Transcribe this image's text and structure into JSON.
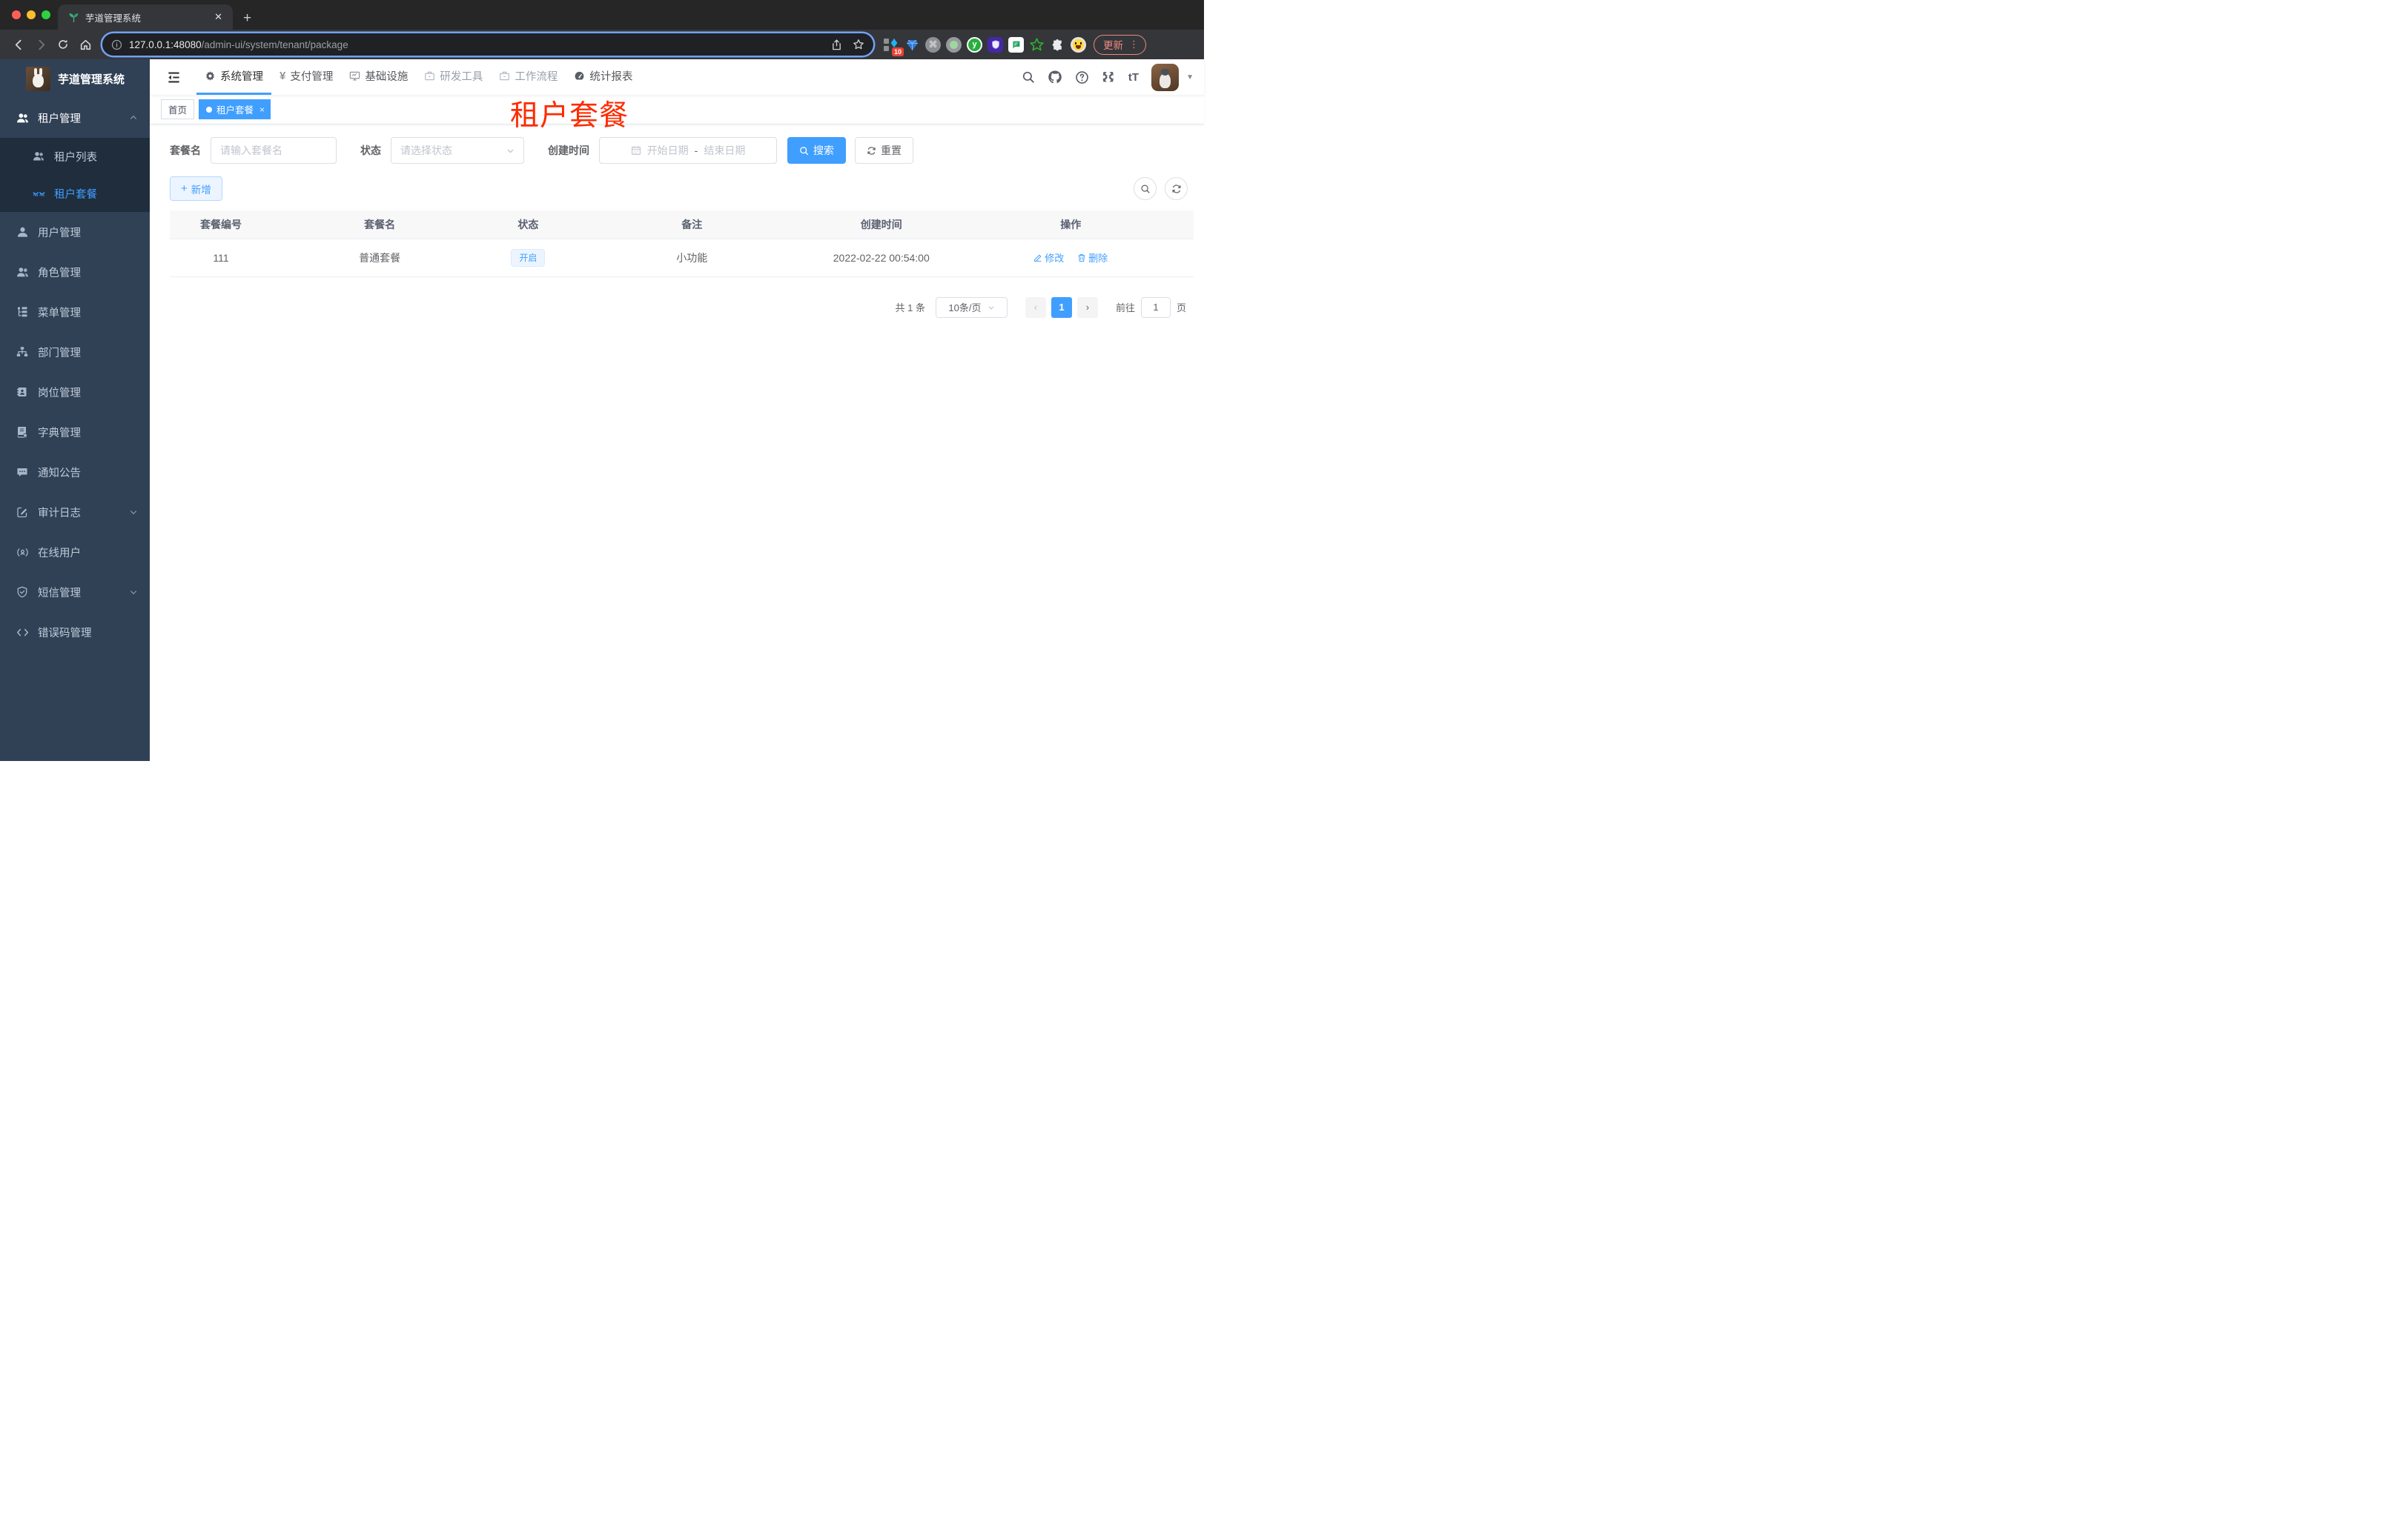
{
  "browser": {
    "tab_title": "芋道管理系统",
    "new_tab": "+",
    "close_tab": "✕",
    "url_host": "127.0.0.1:48080",
    "url_path": "/admin-ui/system/tenant/package",
    "ext_badge": "10",
    "cmd_glyph": "⌘",
    "update_label": "更新",
    "menu_dots": "⋮"
  },
  "colors": {
    "accent": "#409eff",
    "sidebar_bg": "#304156",
    "submenu_bg": "#1f2d3d",
    "annotation_red": "#fe2b00",
    "status_tag_bg": "#ecf5ff",
    "update_chip": "#f08b80"
  },
  "sidebar": {
    "app_title": "芋道管理系统",
    "items": [
      {
        "label": "租户管理",
        "expanded": true,
        "children": [
          {
            "label": "租户列表"
          },
          {
            "label": "租户套餐",
            "active": true
          }
        ]
      },
      {
        "label": "用户管理"
      },
      {
        "label": "角色管理"
      },
      {
        "label": "菜单管理"
      },
      {
        "label": "部门管理"
      },
      {
        "label": "岗位管理"
      },
      {
        "label": "字典管理"
      },
      {
        "label": "通知公告"
      },
      {
        "label": "审计日志",
        "collapsible": true
      },
      {
        "label": "在线用户"
      },
      {
        "label": "短信管理",
        "collapsible": true
      },
      {
        "label": "错误码管理"
      }
    ]
  },
  "topnav": {
    "items": [
      {
        "label": "系统管理",
        "active": true
      },
      {
        "label": "支付管理"
      },
      {
        "label": "基础设施"
      },
      {
        "label": "研发工具"
      },
      {
        "label": "工作流程"
      },
      {
        "label": "统计报表"
      }
    ],
    "font_icon": "tT"
  },
  "tags": [
    {
      "label": "首页"
    },
    {
      "label": "租户套餐",
      "active": true,
      "close": "×"
    }
  ],
  "annotation": {
    "text": "租户套餐"
  },
  "filters": {
    "name_label": "套餐名",
    "name_placeholder": "请输入套餐名",
    "status_label": "状态",
    "status_placeholder": "请选择状态",
    "date_label": "创建时间",
    "date_start_placeholder": "开始日期",
    "date_separator": "-",
    "date_end_placeholder": "结束日期",
    "search_label": "搜索",
    "reset_label": "重置"
  },
  "toolbar": {
    "add_label": "新增"
  },
  "table": {
    "columns": [
      "套餐编号",
      "套餐名",
      "状态",
      "备注",
      "创建时间",
      "操作"
    ],
    "rows": [
      {
        "id": "111",
        "name": "普通套餐",
        "status": "开启",
        "remark": "小功能",
        "created": "2022-02-22 00:54:00",
        "edit": "修改",
        "delete": "删除"
      }
    ]
  },
  "pagination": {
    "total": "共 1 条",
    "page_size": "10条/页",
    "prev": "‹",
    "current": "1",
    "next": "›",
    "goto_prefix": "前往",
    "goto_value": "1",
    "goto_suffix": "页"
  }
}
